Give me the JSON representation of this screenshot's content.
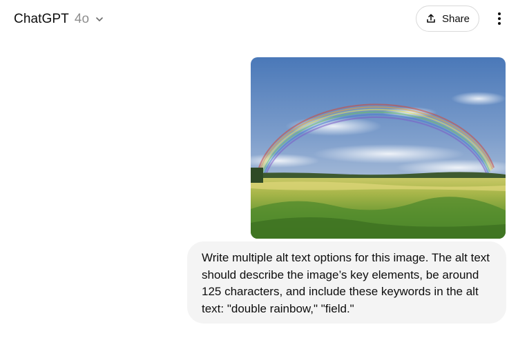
{
  "header": {
    "model_name": "ChatGPT",
    "model_version": "4o",
    "model_chevron_icon": "chevron-down-icon",
    "share_icon": "share-upload-icon",
    "share_label": "Share",
    "more_icon": "vertical-ellipsis-icon"
  },
  "conversation": {
    "messages": [
      {
        "role": "user",
        "attachment": {
          "type": "image"
        },
        "text": "Write multiple alt text options for this image. The alt text should describe the image’s key elements, be around 125 characters, and include these keywords in the alt text: \"double rainbow,\" \"field.\""
      }
    ]
  },
  "colors": {
    "bubble_bg": "#f4f4f4",
    "text": "#0d0d0d",
    "muted": "#8e8e8e",
    "border": "#d9d9d9"
  }
}
